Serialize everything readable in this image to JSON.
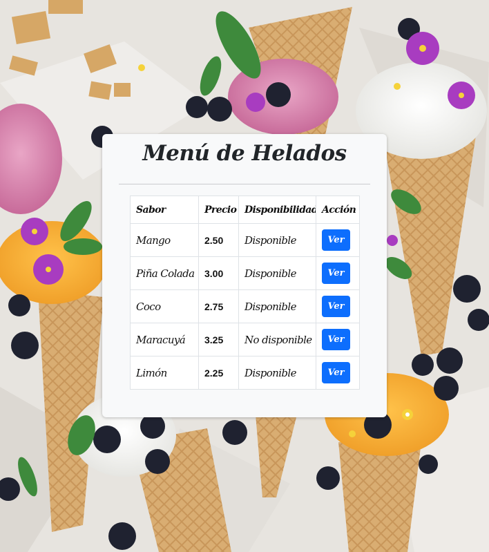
{
  "page": {
    "title": "Menú de Helados"
  },
  "table": {
    "headers": [
      "Sabor",
      "Precio",
      "Disponibilidad",
      "Acción"
    ],
    "rows": [
      {
        "flavor": "Mango",
        "price": "2.50",
        "availability": "Disponible",
        "action": "Ver"
      },
      {
        "flavor": "Piña Colada",
        "price": "3.00",
        "availability": "Disponible",
        "action": "Ver"
      },
      {
        "flavor": "Coco",
        "price": "2.75",
        "availability": "Disponible",
        "action": "Ver"
      },
      {
        "flavor": "Maracuyá",
        "price": "3.25",
        "availability": "No disponible",
        "action": "Ver"
      },
      {
        "flavor": "Limón",
        "price": "2.25",
        "availability": "Disponible",
        "action": "Ver"
      }
    ]
  },
  "colors": {
    "button": "#0d6efd",
    "card": "#f8f9fa",
    "text": "#212529"
  }
}
